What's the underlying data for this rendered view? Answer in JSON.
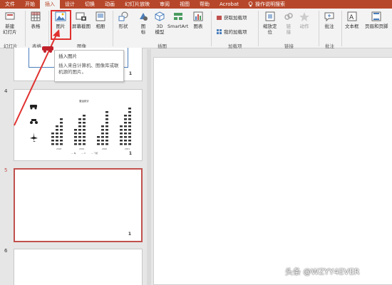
{
  "tabs": [
    "文件",
    "开始",
    "插入",
    "设计",
    "切换",
    "动画",
    "幻灯片放映",
    "审阅",
    "视图",
    "帮助",
    "Acrobat"
  ],
  "active_tab_index": 2,
  "tell_me": "操作说明搜索",
  "ribbon": {
    "new_slide": "新建\n幻灯片",
    "table": "表格",
    "pictures": "图片",
    "screenshot": "屏幕截图",
    "album": "相册",
    "shapes": "形状",
    "icons": "图\n标",
    "model3d": "3D\n模型",
    "smartart": "SmartArt",
    "chart": "图表",
    "get_addins": "获取加载项",
    "my_addins": "我的加载项",
    "zoom": "缩放定\n位",
    "link": "链\n接",
    "action": "动作",
    "comment": "批注",
    "textbox": "文本框",
    "header_footer": "页眉和页脚"
  },
  "groups": {
    "slides": "幻灯片",
    "tables": "表格",
    "images": "图像",
    "illustrations": "插图",
    "addins": "加载项",
    "links": "链接",
    "comments": "批注"
  },
  "tooltip": {
    "title": "插入图片",
    "desc": "插入来自计算机、图像库或联机源的图片。"
  },
  "slides": [
    {
      "num": "4",
      "active": false
    },
    {
      "num": "5",
      "active": true
    },
    {
      "num": "6",
      "active": false
    }
  ],
  "thumb_chart": {
    "title": "营运统计",
    "categories": [
      "2018",
      "2019",
      "2020",
      "2021"
    ],
    "legend": [
      "车",
      "人",
      "飞机"
    ]
  },
  "watermark": "头条 @WZYY4EVER",
  "colors": {
    "accent": "#b7472a",
    "highlight": "#e0312f",
    "active_slide": "#c0504d"
  }
}
